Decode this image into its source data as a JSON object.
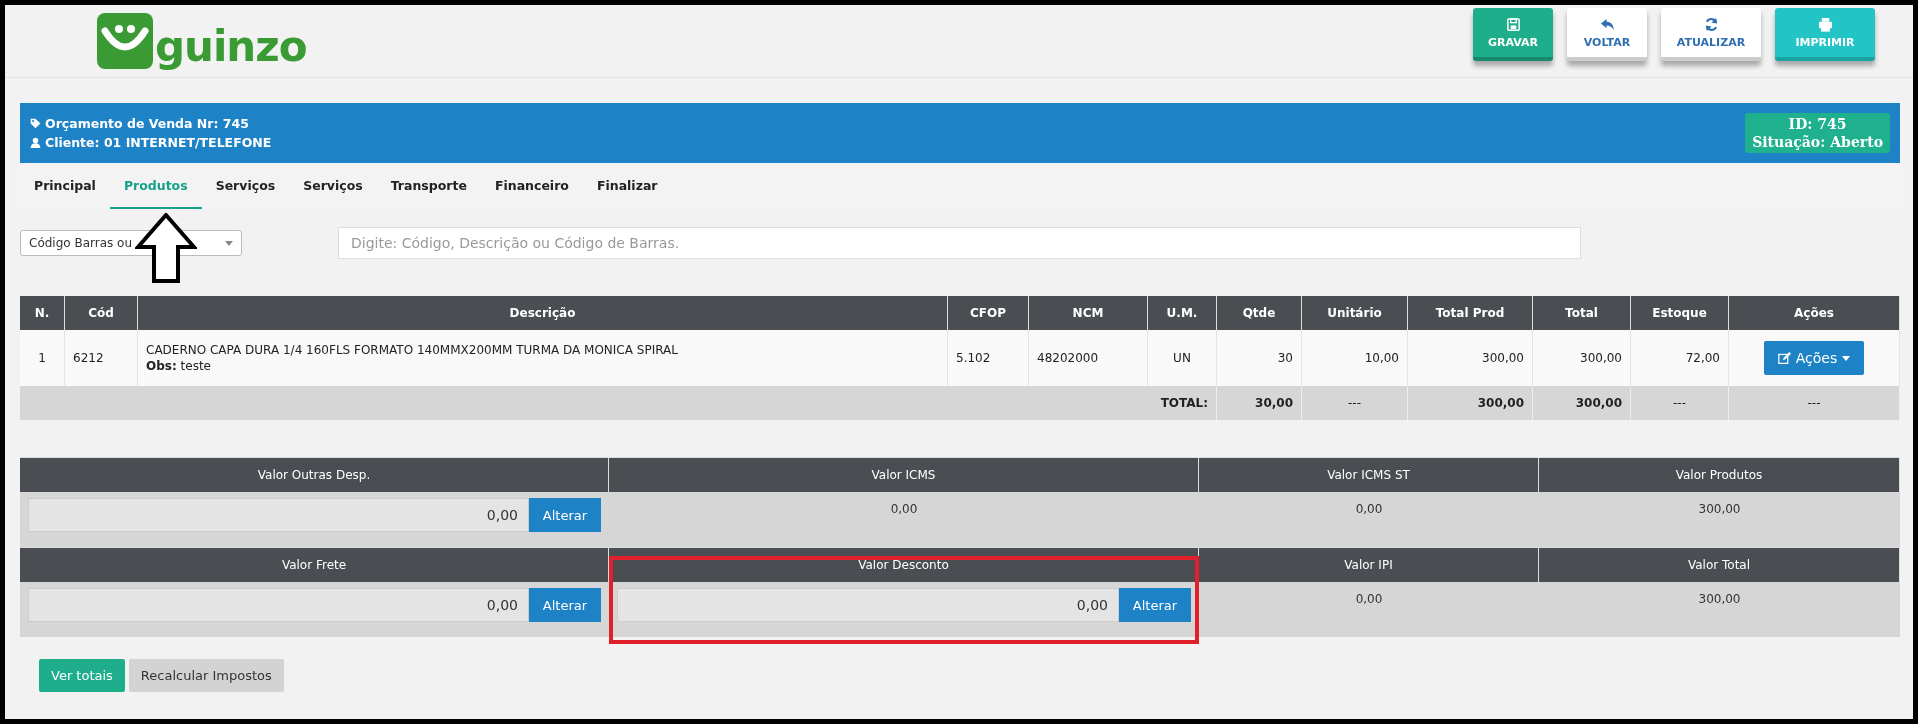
{
  "logo": {
    "text": "guinzo"
  },
  "toolbar": [
    {
      "label": "GRAVAR",
      "kind": "save"
    },
    {
      "label": "VOLTAR",
      "kind": "back"
    },
    {
      "label": "ATUALIZAR",
      "kind": "refresh"
    },
    {
      "label": "IMPRIMIR",
      "kind": "print"
    }
  ],
  "header": {
    "title": "Orçamento de Venda Nr: 745",
    "client": "Cliente: 01 INTERNET/TELEFONE",
    "id": "ID: 745",
    "status": "Situação: Aberto"
  },
  "tabs": [
    {
      "label": "Principal",
      "selected": false
    },
    {
      "label": "Produtos",
      "selected": true
    },
    {
      "label": "Serviços",
      "selected": false
    },
    {
      "label": "Serviços",
      "selected": false
    },
    {
      "label": "Transporte",
      "selected": false
    },
    {
      "label": "Financeiro",
      "selected": false
    },
    {
      "label": "Finalizar",
      "selected": false
    }
  ],
  "search": {
    "mode": "Código Barras ou",
    "placeholder": "Digite: Código, Descrição ou Código de Barras."
  },
  "table": {
    "columns": [
      "N.",
      "Cód",
      "Descrição",
      "CFOP",
      "NCM",
      "U.M.",
      "Qtde",
      "Unitário",
      "Total Prod",
      "Total",
      "Estoque",
      "Ações"
    ],
    "rows": [
      {
        "n": "1",
        "code": "6212",
        "description": "CADERNO CAPA DURA 1/4 160FLS FORMATO 140MMX200MM TURMA DA MONICA SPIRAL",
        "obs": "**Obs:** teste",
        "cfop": "5.102",
        "ncm": "48202000",
        "unit": "UN",
        "qty": "30",
        "unit_price": "10,00",
        "total_prod": "300,00",
        "total": "300,00",
        "stock": "72,00",
        "action": "Ações"
      }
    ],
    "totals": {
      "label": "TOTAL:",
      "qty": "30,00",
      "unit_price": "---",
      "total_prod": "300,00",
      "total": "300,00",
      "stock": "---",
      "actions": "---"
    }
  },
  "summary": [
    {
      "label": "Valor Outras Desp.",
      "kind": "input",
      "value": "0,00",
      "button": "Alterar"
    },
    {
      "label": "Valor ICMS",
      "kind": "text",
      "value": "0,00"
    },
    {
      "label": "Valor ICMS ST",
      "kind": "text",
      "value": "0,00"
    },
    {
      "label": "Valor Produtos",
      "kind": "text",
      "value": "300,00"
    },
    {
      "label": "Valor Frete",
      "kind": "input",
      "value": "0,00",
      "button": "Alterar"
    },
    {
      "label": "Valor Desconto",
      "kind": "input",
      "value": "0,00",
      "button": "Alterar"
    },
    {
      "label": "Valor IPI",
      "kind": "text",
      "value": "0,00"
    },
    {
      "label": "Valor Total",
      "kind": "text",
      "value": "300,00"
    }
  ],
  "footer_buttons": [
    {
      "label": "Ver totais",
      "kind": "primary"
    },
    {
      "label": "Recalcular Impostos",
      "kind": "secondary"
    }
  ]
}
